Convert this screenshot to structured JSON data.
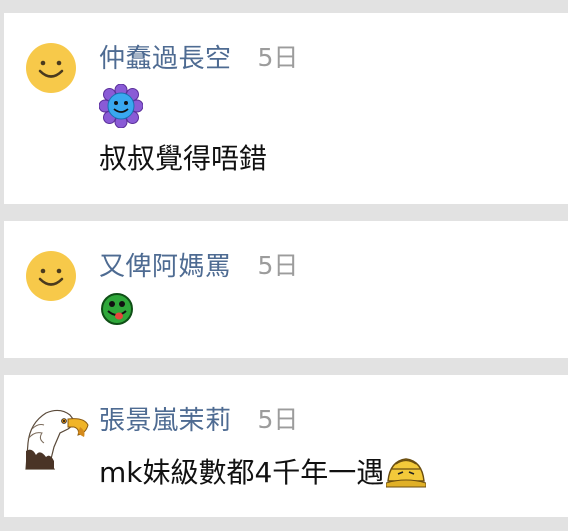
{
  "comments": [
    {
      "author": "仲蠢過長空",
      "time": "5日",
      "avatar_icon": "smiley-avatar-icon",
      "emoticon": "blue-flower-face-icon",
      "text": "叔叔覺得唔錯"
    },
    {
      "author": "又俾阿媽罵",
      "time": "5日",
      "avatar_icon": "smiley-avatar-icon",
      "emoticon": "green-tongue-face-icon",
      "text": ""
    },
    {
      "author": "張景嵐茉莉",
      "time": "5日",
      "avatar_icon": "eagle-avatar-icon",
      "emoticon": "bowing-face-icon",
      "text": "mk妹級數都4千年一遇"
    }
  ],
  "colors": {
    "author": "#4e6b92",
    "time": "#9c9c9c",
    "separator": "#e2e2e2",
    "avatar_yellow": "#f7c94a"
  }
}
